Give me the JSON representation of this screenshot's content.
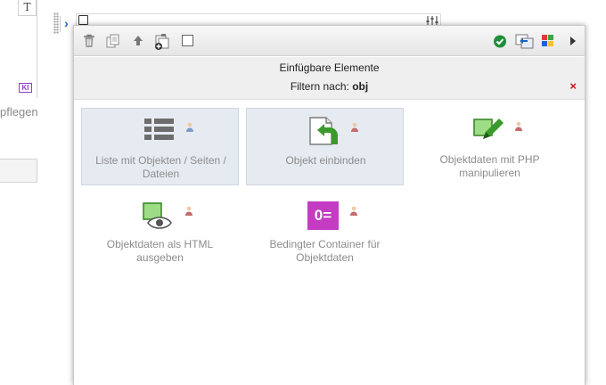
{
  "left": {
    "t_icon_glyph": "T",
    "ki_badge": "KI",
    "partial_text": "pflegen"
  },
  "bg_editor": {
    "chevron_glyph": "›"
  },
  "panel": {
    "toolbar": {
      "icons": [
        "trash-icon",
        "copy-icon",
        "move-up-icon",
        "duplicate-icon",
        "checkbox-icon",
        "check-circle-icon",
        "swap-icon",
        "color-grid-icon",
        "play-icon"
      ]
    },
    "header": {
      "title": "Einfügbare Elemente",
      "filter_label": "Filtern nach:",
      "filter_value": "obj",
      "clear_glyph": "×"
    },
    "tiles": [
      {
        "label": "Liste mit Objekten / Seiten / Dateien",
        "icon": "list-icon",
        "person_color": "#7a9ccc",
        "selected": true
      },
      {
        "label": "Objekt einbinden",
        "icon": "embed-object-icon",
        "person_color": "#c66b6b",
        "selected": true
      },
      {
        "label": "Objektdaten mit PHP manipulieren",
        "icon": "php-edit-icon",
        "person_color": "#c66b6b",
        "selected": false
      },
      {
        "label": "Objektdaten als HTML ausgeben",
        "icon": "eye-icon",
        "person_color": "#c66b6b",
        "selected": false
      },
      {
        "label": "Bedingter Container für Objektdaten",
        "icon": "conditional-container-icon",
        "person_color": "#c66b6b",
        "selected": false,
        "icon_text": "0="
      }
    ],
    "colors": {
      "accent_magenta": "#c43cc4",
      "accent_green": "#7ac943",
      "check_green": "#1f8f3a",
      "clear_red": "#cc1111"
    }
  }
}
